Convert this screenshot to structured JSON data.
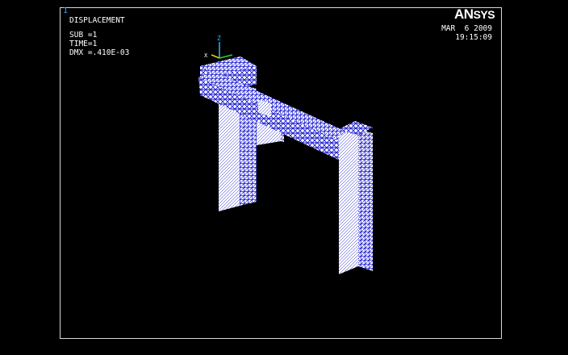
{
  "window": {
    "number": "1"
  },
  "result": {
    "title": "DISPLACEMENT",
    "sub": "SUB =1",
    "time": "TIME=1",
    "dmx": "DMX =.410E-03"
  },
  "brand": {
    "an": "AN",
    "sys": "SYS"
  },
  "timestamp": {
    "date": "MAR  6 2009",
    "time": "19:15:09"
  },
  "triad": {
    "z_label": "Z",
    "x_label": "X"
  },
  "colors": {
    "background": "#000000",
    "mesh_white": "#ffffff",
    "mesh_blue": "#1a1ad0",
    "window_number": "#3ea8ff",
    "triad_z": "#2fb4ff",
    "triad_y": "#2fd02f",
    "triad_x": "#d8d800"
  }
}
